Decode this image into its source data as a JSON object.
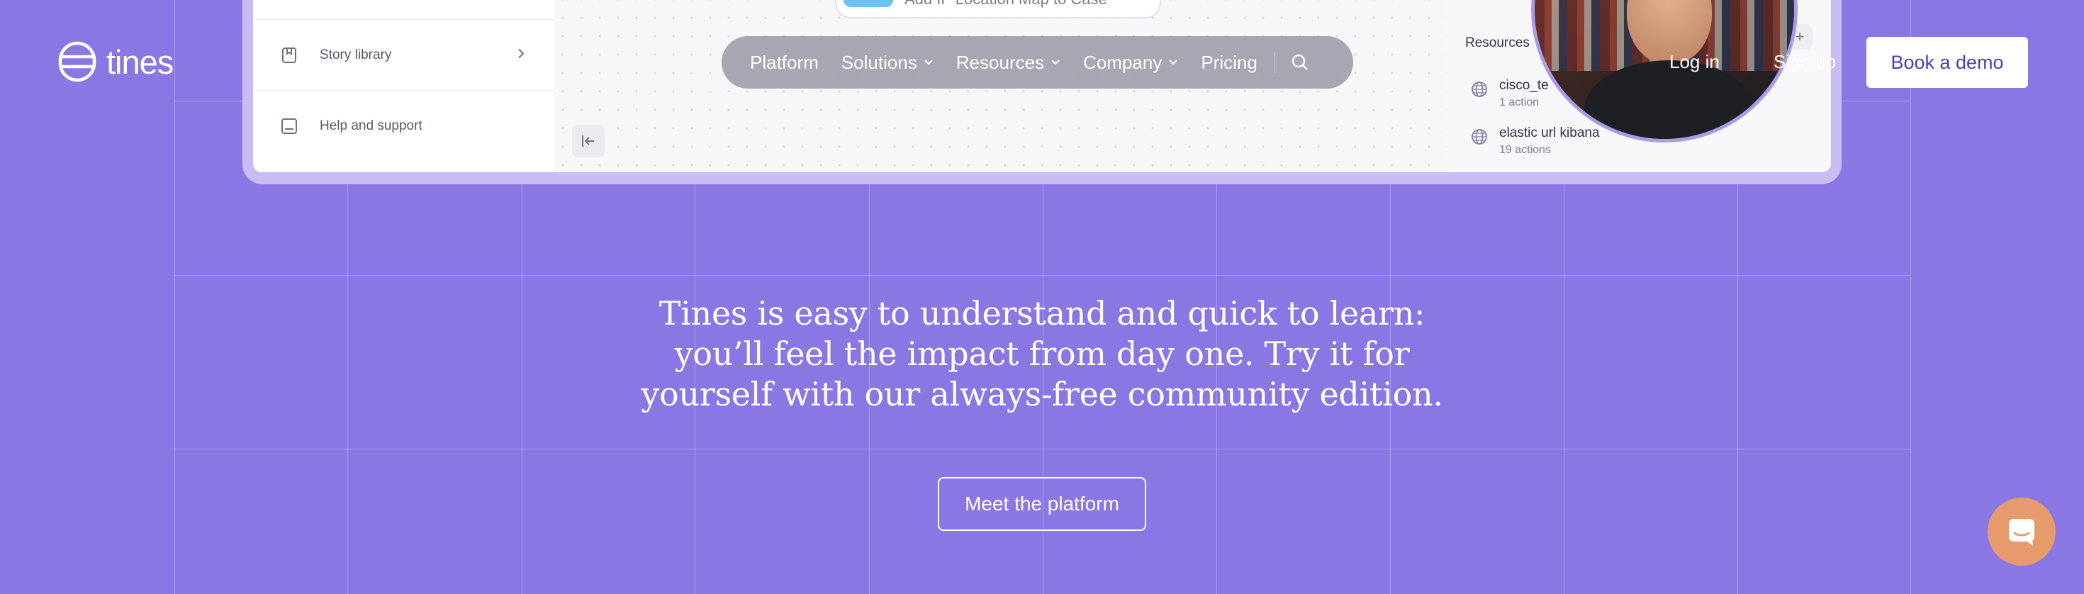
{
  "brand": {
    "name": "tines"
  },
  "nav": {
    "items": [
      {
        "label": "Platform",
        "has_dropdown": false
      },
      {
        "label": "Solutions",
        "has_dropdown": true
      },
      {
        "label": "Resources",
        "has_dropdown": true
      },
      {
        "label": "Company",
        "has_dropdown": true
      },
      {
        "label": "Pricing",
        "has_dropdown": false
      }
    ],
    "search_icon": "search-icon"
  },
  "header_actions": {
    "login_label": "Log in",
    "signup_label": "Sign up",
    "demo_label": "Book a demo"
  },
  "preview": {
    "sidebar": [
      {
        "label": "Story library",
        "icon": "book-icon"
      },
      {
        "label": "Help and support",
        "icon": "chat-icon"
      }
    ],
    "story_chip_text": "Add IP Location Map to Case",
    "resources": {
      "title": "Resources",
      "items": [
        {
          "name": "cisco_te",
          "count": "1 action"
        },
        {
          "name": "elastic url kibana",
          "count": "19 actions"
        }
      ]
    }
  },
  "hero": {
    "text": "Tines is easy to understand and quick to learn: you’ll feel the impact from day one. Try it for yourself with our always-free community edition.",
    "cta_label": "Meet the platform"
  },
  "colors": {
    "background": "#8b77e3",
    "demo_text": "#4b3fb0",
    "chat_launcher": "#e79a6c"
  }
}
